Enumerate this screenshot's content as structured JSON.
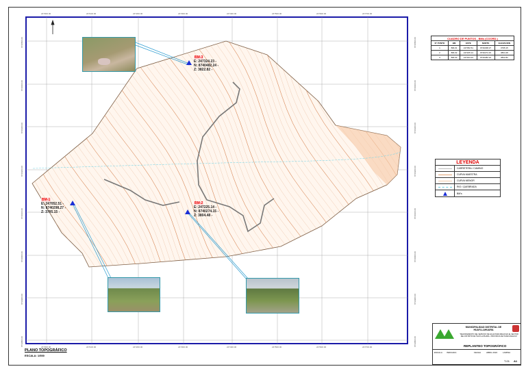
{
  "sheet": {
    "title": "PLANO TOPOGRÁFICO",
    "scale": "ESCALA: 1/500",
    "subtitle": "LEVANTAMIENTO"
  },
  "grid": {
    "x_labels": [
      "247000.00",
      "247100.00",
      "247200.00",
      "247300.00",
      "247400.00",
      "247500.00",
      "247600.00",
      "247700.00"
    ],
    "y_labels": [
      "8740500.00",
      "8740400.00",
      "8740300.00",
      "8740200.00",
      "8740100.00",
      "8740000.00",
      "8739900.00",
      "8739800.00"
    ]
  },
  "benchmarks": [
    {
      "name": "BM-3",
      "e": "E: 247324.23 -",
      "n": "N: 8740482.24 -",
      "z": "Z: 3822.82 -"
    },
    {
      "name": "BM-1",
      "e": "E: 247052.51 -",
      "n": "N: 8740298.27 -",
      "z": "Z: 3795.15 -"
    },
    {
      "name": "BM-2",
      "e": "E: 247225.14 -",
      "n": "N: 8740274.15 -",
      "z": "Z: 3804.48 -"
    }
  ],
  "points_table": {
    "title": "CUADRO DE PUNTOS - BMs (COORD.)",
    "headers": [
      "N° PUNTO",
      "BM",
      "ESTE",
      "NORTE",
      "ELEVACION"
    ],
    "rows": [
      [
        "1",
        "BM-01",
        "247052.51",
        "8740298.27",
        "3795.15"
      ],
      [
        "2",
        "BM-02",
        "247225.14",
        "8740274.15",
        "3804.48"
      ],
      [
        "3",
        "BM-03",
        "247324.23",
        "8740482.24",
        "3822.82"
      ]
    ]
  },
  "legend": {
    "title": "LEYENDA",
    "items": [
      "CARRETERA / CAMINO",
      "CURVA MAESTRA",
      "CURVA MENOR",
      "RIO / QUEBRADA",
      "BM's"
    ]
  },
  "title_block": {
    "entity": "MUNICIPALIDAD DISTRITAL DE HUAYLLAHUARA",
    "project": "\"MEJORAMIENTO DEL SERVICIO DE AGUA PARA RIEGO EN EL SECTOR DEL DISTRITO DE HUAYLLAHUARA - PROVINCIA DE HUANCAVELICA\"",
    "plan": "REPLANTEO TOPOGRÁFICO",
    "fields": [
      "ESCALA",
      "INDICADA",
      "FECHA",
      "ABRIL 2024",
      "LAMINA",
      "T-01",
      "A1"
    ]
  },
  "colors": {
    "frame": "#1a1aa8",
    "contour": "#d9a07a",
    "river": "#7fd6e6",
    "bm": "#1a2fd6"
  }
}
